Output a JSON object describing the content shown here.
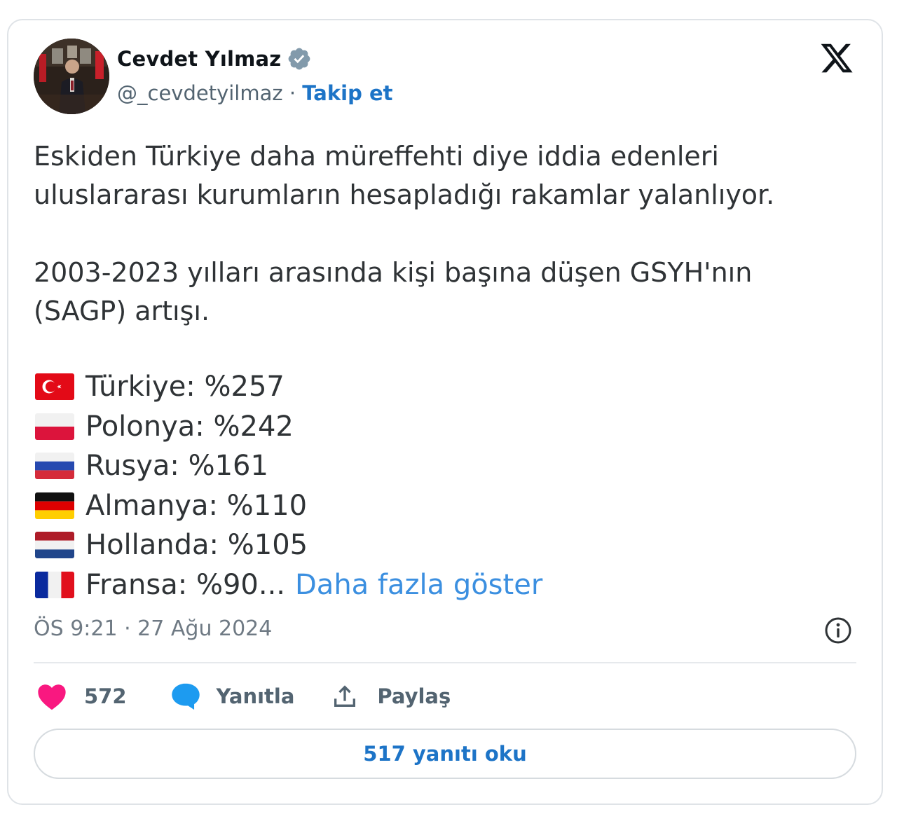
{
  "author": {
    "name": "Cevdet Yılmaz",
    "handle": "@_cevdetyilmaz",
    "separator": "·",
    "follow_label": "Takip et"
  },
  "tweet": {
    "paragraphs": [
      [
        "Eskiden Türkiye daha müreffehti diye iddia edenleri",
        "uluslararası kurumların hesapladığı rakamlar yalanlıyor."
      ],
      [
        "2003-2023 yılları arasında kişi başına düşen GSYH'nın",
        "(SAGP) artışı."
      ]
    ],
    "stats": [
      {
        "flag": "turkey-flag-icon",
        "text": "Türkiye: %257"
      },
      {
        "flag": "poland-flag-icon",
        "text": "Polonya: %242"
      },
      {
        "flag": "russia-flag-icon",
        "text": "Rusya: %161"
      },
      {
        "flag": "germany-flag-icon",
        "text": "Almanya: %110"
      },
      {
        "flag": "netherlands-flag-icon",
        "text": "Hollanda: %105"
      },
      {
        "flag": "france-flag-icon",
        "text": "Fransa: %90..."
      }
    ],
    "show_more_label": "Daha fazla göster",
    "timestamp": "ÖS 9:21 · 27 Ağu 2024"
  },
  "actions": {
    "like_count": "572",
    "reply_label": "Yanıtla",
    "share_label": "Paylaş"
  },
  "read_replies_label": "517 yanıtı oku",
  "colors": {
    "link": "#1d74c7",
    "show_more": "#3b8fe0",
    "like": "#f91880",
    "reply": "#1d9bf0"
  }
}
